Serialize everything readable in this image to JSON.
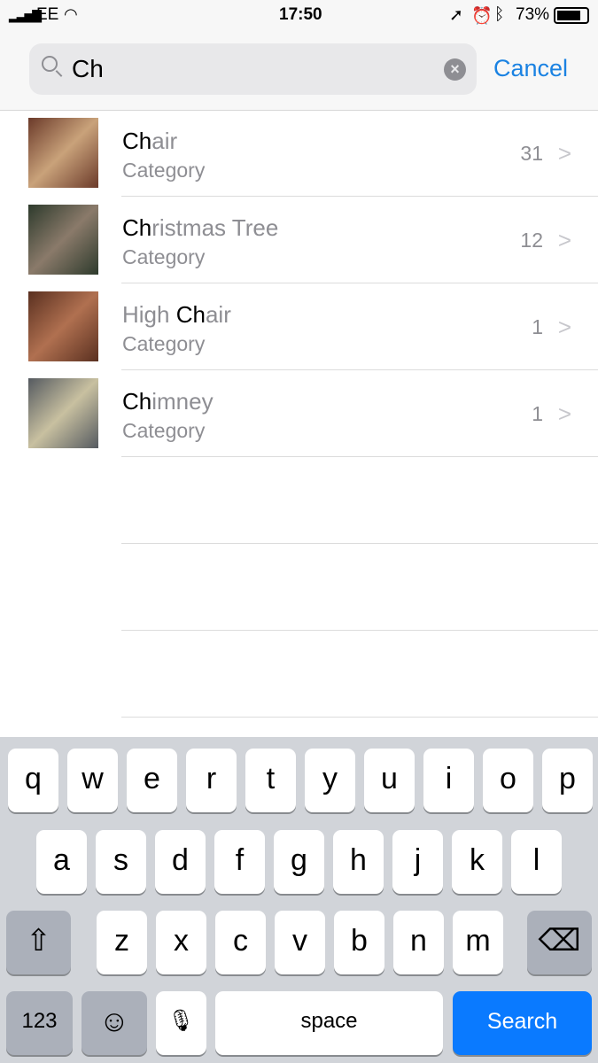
{
  "status": {
    "carrier": "EE",
    "time": "17:50",
    "battery": "73%"
  },
  "search": {
    "query": "Ch",
    "cancel": "Cancel"
  },
  "results": [
    {
      "match": "Ch",
      "rest": "air",
      "pre": "",
      "subtitle": "Category",
      "count": "31",
      "thumb": [
        "#6b3a2a",
        "#c9a27a"
      ]
    },
    {
      "match": "Ch",
      "rest": "ristmas Tree",
      "pre": "",
      "subtitle": "Category",
      "count": "12",
      "thumb": [
        "#2d3a2c",
        "#8a7a6a"
      ]
    },
    {
      "match": "Ch",
      "rest": "air",
      "pre": "High ",
      "subtitle": "Category",
      "count": "1",
      "thumb": [
        "#5a3020",
        "#b07050"
      ]
    },
    {
      "match": "Ch",
      "rest": "imney",
      "pre": "",
      "subtitle": "Category",
      "count": "1",
      "thumb": [
        "#555a60",
        "#c8c0a0"
      ]
    }
  ],
  "keyboard": {
    "row1": [
      "q",
      "w",
      "e",
      "r",
      "t",
      "y",
      "u",
      "i",
      "o",
      "p"
    ],
    "row2": [
      "a",
      "s",
      "d",
      "f",
      "g",
      "h",
      "j",
      "k",
      "l"
    ],
    "row3": [
      "z",
      "x",
      "c",
      "v",
      "b",
      "n",
      "m"
    ],
    "numbers": "123",
    "space": "space",
    "search": "Search"
  },
  "colors": {
    "accent": "#1a82e2",
    "search_key": "#0a7aff"
  }
}
